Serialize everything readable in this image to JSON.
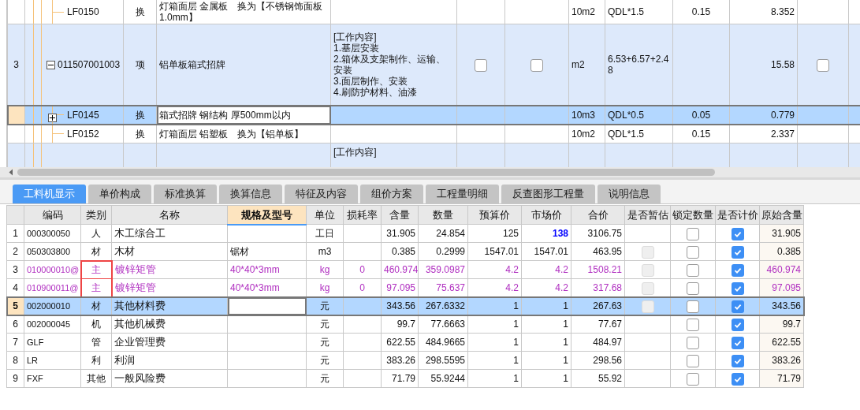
{
  "upper_table": {
    "rows": [
      {
        "kind": "sub",
        "code": "LF0150",
        "type": "换",
        "name": "灯箱面层 金属板　换为【不锈钢饰面板1.0mm】",
        "unit": "10m2",
        "formula": "QDL*1.5",
        "coefficient": "0.15",
        "quantity": "8.352",
        "selected": false
      },
      {
        "kind": "item",
        "row_number": "3",
        "code": "011507001003",
        "expanded": true,
        "type": "项",
        "name": "铝单板箱式招牌",
        "features": [
          "[工作内容]",
          "1.基层安装",
          "2.箱体及支架制作、运输、安装",
          "3.面层制作、安装",
          "4.刷防护材料、油漆"
        ],
        "checks": [
          false,
          false,
          false
        ],
        "unit": "m2",
        "formula": "6.53+6.57+2.48",
        "quantity": "15.58",
        "selected": false
      },
      {
        "kind": "sub",
        "code": "LF0145",
        "expanded": false,
        "type": "换",
        "name": "箱式招牌 钢结构 厚500mm以内",
        "unit": "10m3",
        "formula": "QDL*0.5",
        "coefficient": "0.05",
        "quantity": "0.779",
        "selected": true
      },
      {
        "kind": "sub",
        "code": "LF0152",
        "type": "换",
        "name": "灯箱面层 铝塑板　换为【铝单板】",
        "unit": "10m2",
        "formula": "QDL*1.5",
        "coefficient": "0.15",
        "quantity": "2.337",
        "selected": false
      },
      {
        "kind": "item",
        "features": [
          "[工作内容]"
        ],
        "selected": false
      }
    ]
  },
  "tabs": [
    {
      "label": "工料机显示",
      "selected": true
    },
    {
      "label": "单价构成",
      "selected": false
    },
    {
      "label": "标准换算",
      "selected": false
    },
    {
      "label": "换算信息",
      "selected": false
    },
    {
      "label": "特征及内容",
      "selected": false
    },
    {
      "label": "组价方案",
      "selected": false
    },
    {
      "label": "工程量明细",
      "selected": false
    },
    {
      "label": "反查图形工程量",
      "selected": false
    },
    {
      "label": "说明信息",
      "selected": false
    }
  ],
  "resource_table": {
    "columns": [
      {
        "label": "编码",
        "selected": false
      },
      {
        "label": "类别",
        "selected": false
      },
      {
        "label": "名称",
        "selected": false
      },
      {
        "label": "规格及型号",
        "selected": true
      },
      {
        "label": "单位",
        "selected": false
      },
      {
        "label": "损耗率",
        "selected": false
      },
      {
        "label": "含量",
        "selected": false
      },
      {
        "label": "数量",
        "selected": false
      },
      {
        "label": "预算价",
        "selected": false
      },
      {
        "label": "市场价",
        "selected": false
      },
      {
        "label": "合价",
        "selected": false
      },
      {
        "label": "是否暂估",
        "selected": false
      },
      {
        "label": "锁定数量",
        "selected": false
      },
      {
        "label": "是否计价",
        "selected": false
      },
      {
        "label": "原始含量",
        "selected": false
      }
    ],
    "rows": [
      {
        "number": "1",
        "code": "000300050",
        "type": "人",
        "name": "木工综合工",
        "spec": "",
        "unit": "工日",
        "loss": "",
        "content": "31.905",
        "quantity": "24.854",
        "budget_price": "125",
        "market_price": "138",
        "market_adjusted": true,
        "total": "3106.75",
        "estimate_box": false,
        "locked": false,
        "priced": true,
        "original": "31.905",
        "kind": "normal",
        "highlighted": false,
        "selected": false
      },
      {
        "number": "2",
        "code": "050303800",
        "type": "材",
        "name": "木材",
        "spec": "锯材",
        "unit": "m3",
        "loss": "",
        "content": "0.385",
        "quantity": "0.2999",
        "budget_price": "1547.01",
        "market_price": "1547.01",
        "market_adjusted": false,
        "total": "463.95",
        "estimate_box": true,
        "locked": false,
        "priced": true,
        "original": "0.385",
        "kind": "normal",
        "highlighted": false,
        "selected": false
      },
      {
        "number": "3",
        "code": "010000010@",
        "type": "主",
        "name": "镀锌矩管",
        "spec": "40*40*3mm",
        "unit": "kg",
        "loss": "0",
        "content": "460.974",
        "quantity": "359.0987",
        "budget_price": "4.2",
        "market_price": "4.2",
        "market_adjusted": false,
        "total": "1508.21",
        "estimate_box": true,
        "locked": false,
        "priced": true,
        "original": "460.974",
        "kind": "main",
        "highlighted": true,
        "selected": false
      },
      {
        "number": "4",
        "code": "010900011@",
        "type": "主",
        "name": "镀锌矩管",
        "spec": "40*40*3mm",
        "unit": "kg",
        "loss": "0",
        "content": "97.095",
        "quantity": "75.637",
        "budget_price": "4.2",
        "market_price": "4.2",
        "market_adjusted": false,
        "total": "317.68",
        "estimate_box": true,
        "locked": false,
        "priced": true,
        "original": "97.095",
        "kind": "main",
        "highlighted": true,
        "selected": false
      },
      {
        "number": "5",
        "code": "002000010",
        "type": "材",
        "name": "其他材料费",
        "spec": "",
        "unit": "元",
        "loss": "",
        "content": "343.56",
        "quantity": "267.6332",
        "budget_price": "1",
        "market_price": "1",
        "market_adjusted": false,
        "total": "267.63",
        "estimate_box": true,
        "locked": false,
        "priced": true,
        "original": "343.56",
        "kind": "normal",
        "highlighted": false,
        "selected": true
      },
      {
        "number": "6",
        "code": "002000045",
        "type": "机",
        "name": "其他机械费",
        "spec": "",
        "unit": "元",
        "loss": "",
        "content": "99.7",
        "quantity": "77.6663",
        "budget_price": "1",
        "market_price": "1",
        "market_adjusted": false,
        "total": "77.67",
        "estimate_box": false,
        "locked": false,
        "priced": true,
        "original": "99.7",
        "kind": "normal",
        "highlighted": false,
        "selected": false
      },
      {
        "number": "7",
        "code": "GLF",
        "type": "管",
        "name": "企业管理费",
        "spec": "",
        "unit": "元",
        "loss": "",
        "content": "622.55",
        "quantity": "484.9665",
        "budget_price": "1",
        "market_price": "1",
        "market_adjusted": false,
        "total": "484.97",
        "estimate_box": false,
        "locked": false,
        "priced": true,
        "original": "622.55",
        "kind": "normal",
        "highlighted": false,
        "selected": false
      },
      {
        "number": "8",
        "code": "LR",
        "type": "利",
        "name": "利润",
        "spec": "",
        "unit": "元",
        "loss": "",
        "content": "383.26",
        "quantity": "298.5595",
        "budget_price": "1",
        "market_price": "1",
        "market_adjusted": false,
        "total": "298.56",
        "estimate_box": false,
        "locked": false,
        "priced": true,
        "original": "383.26",
        "kind": "normal",
        "highlighted": false,
        "selected": false
      },
      {
        "number": "9",
        "code": "FXF",
        "type": "其他",
        "name": "一般风险费",
        "spec": "",
        "unit": "元",
        "loss": "",
        "content": "71.79",
        "quantity": "55.9244",
        "budget_price": "1",
        "market_price": "1",
        "market_adjusted": false,
        "total": "55.92",
        "estimate_box": false,
        "locked": false,
        "priced": true,
        "original": "71.79",
        "kind": "normal",
        "highlighted": false,
        "selected": false
      }
    ]
  }
}
